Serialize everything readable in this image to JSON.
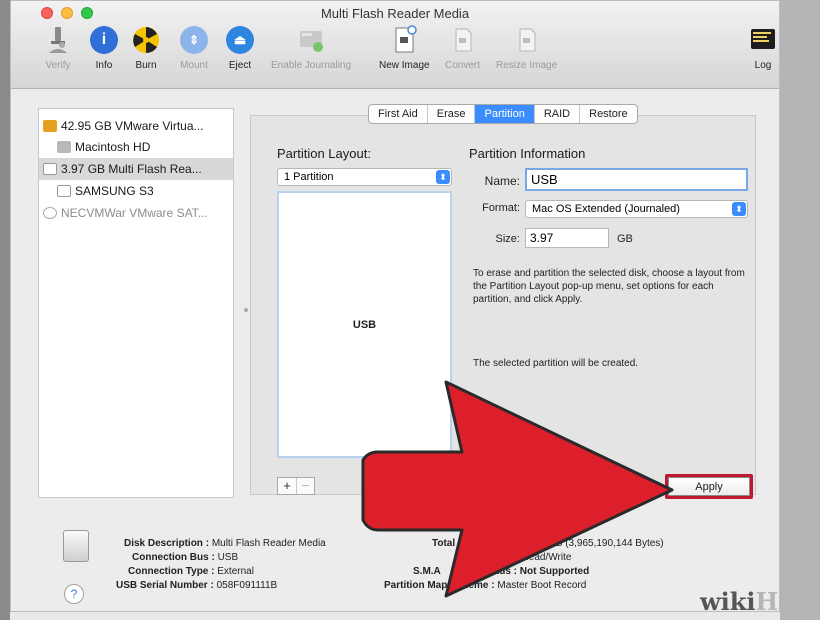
{
  "window": {
    "title": "Multi Flash Reader Media"
  },
  "toolbar": {
    "items": [
      {
        "label": "Verify",
        "icon": "microscope-icon",
        "enabled": false
      },
      {
        "label": "Info",
        "icon": "info-icon",
        "enabled": true
      },
      {
        "label": "Burn",
        "icon": "burn-icon",
        "enabled": true
      },
      {
        "label": "Mount",
        "icon": "mount-icon",
        "enabled": false
      },
      {
        "label": "Eject",
        "icon": "eject-icon",
        "enabled": true
      },
      {
        "label": "Enable Journaling",
        "icon": "journaling-icon",
        "enabled": false
      },
      {
        "label": "New Image",
        "icon": "new-image-icon",
        "enabled": true
      },
      {
        "label": "Convert",
        "icon": "convert-icon",
        "enabled": false
      },
      {
        "label": "Resize Image",
        "icon": "resize-image-icon",
        "enabled": false
      },
      {
        "label": "Log",
        "icon": "log-icon",
        "enabled": true
      }
    ]
  },
  "sidebar": {
    "items": [
      {
        "label": "42.95 GB VMware Virtua..."
      },
      {
        "label": "Macintosh HD"
      },
      {
        "label": "3.97 GB Multi Flash Rea..."
      },
      {
        "label": "SAMSUNG S3"
      },
      {
        "label": "NECVMWar VMware SAT..."
      }
    ]
  },
  "tabs": [
    "First Aid",
    "Erase",
    "Partition",
    "RAID",
    "Restore"
  ],
  "partition": {
    "layout_title": "Partition Layout:",
    "layout_value": "1 Partition",
    "partition_name": "USB",
    "info_title": "Partition Information",
    "name_label": "Name:",
    "name_value": "USB",
    "format_label": "Format:",
    "format_value": "Mac OS Extended (Journaled)",
    "size_label": "Size:",
    "size_value": "3.97",
    "size_unit": "GB",
    "description": "To erase and partition the selected disk, choose a layout from the Partition Layout pop-up menu, set options for each partition, and click Apply.",
    "status": "The selected partition will be created.",
    "plus": "+",
    "minus": "−",
    "apply": "Apply"
  },
  "footer": {
    "disk_description_label": "Disk Description :",
    "disk_description": "Multi Flash Reader Media",
    "connection_bus_label": "Connection Bus :",
    "connection_bus": "USB",
    "connection_type_label": "Connection Type :",
    "connection_type": "External",
    "serial_label": "USB Serial Number :",
    "serial": "058F091111B",
    "total_label": "Total",
    "capacity": "GB (3,965,190,144 Bytes)",
    "write_label": "W",
    "write_status": ": Read/Write",
    "smart_label": "S.M.A",
    "smart_status": "tatus : Not Supported",
    "partition_map_label": "Partition Map Scheme :",
    "partition_map": "Master Boot Record",
    "help": "?"
  },
  "watermark": {
    "wiki": "wiki",
    "how": "How"
  },
  "colors": {
    "accent": "#3b8dff",
    "arrow": "#dd1f2c",
    "apply_border": "#c01830"
  }
}
